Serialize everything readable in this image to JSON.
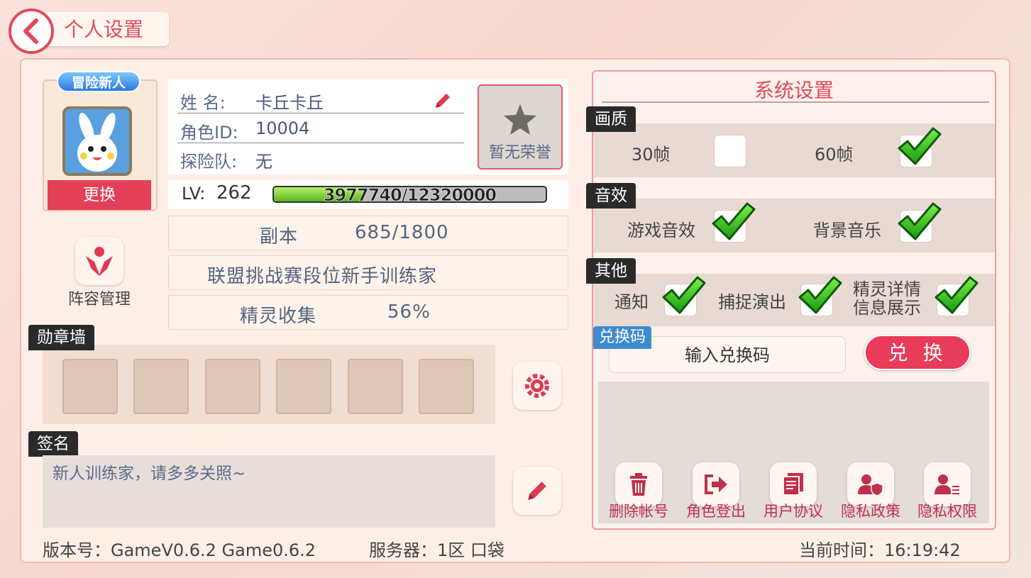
{
  "header": {
    "title": "个人设置"
  },
  "profile": {
    "badge": "冒险新人",
    "change_label": "更换",
    "roster_label": "阵容管理",
    "name_label": "姓  名:",
    "name_value": "卡丘卡丘",
    "id_label": "角色ID:",
    "id_value": "10004",
    "team_label": "探险队:",
    "team_value": "无",
    "honor_label": "暂无荣誉",
    "lv_label": "LV:",
    "lv_value": "262",
    "exp_text": "3977740/12320000",
    "exp_progress": 0.3228
  },
  "stats": {
    "dungeon_label": "副本",
    "dungeon_value": "685/1800",
    "league_text": "联盟挑战赛段位新手训练家",
    "collection_label": "精灵收集",
    "collection_value": "56%"
  },
  "medals": {
    "label": "勋章墙",
    "slots": 6
  },
  "signature": {
    "label": "签名",
    "text": "新人训练家，请多多关照~"
  },
  "footer": {
    "version": "版本号：GameV0.6.2 Game0.6.2",
    "server": "服务器：1区 口袋",
    "time": "当前时间：16:19:42"
  },
  "system": {
    "title": "系统设置",
    "quality": {
      "label": "画质",
      "opt30": "30帧",
      "opt60": "60帧",
      "opt30_checked": false,
      "opt60_checked": true
    },
    "sound": {
      "label": "音效",
      "game_sfx": "游戏音效",
      "bgm": "背景音乐"
    },
    "other": {
      "label": "其他",
      "notify": "通知",
      "capture": "捕捉演出",
      "detail_line1": "精灵详情",
      "detail_line2": "信息展示"
    },
    "redeem": {
      "tag": "兑换码",
      "placeholder": "输入兑换码",
      "button": "兑 换"
    },
    "actions": [
      {
        "label": "删除帐号",
        "icon": "trash-icon"
      },
      {
        "label": "角色登出",
        "icon": "logout-icon"
      },
      {
        "label": "用户协议",
        "icon": "document-icon"
      },
      {
        "label": "隐私政策",
        "icon": "privacy-shield-icon"
      },
      {
        "label": "隐私权限",
        "icon": "privacy-permission-icon"
      }
    ]
  },
  "colors": {
    "accent": "#e24a5d",
    "button_red": "#e43f58",
    "exp_green": "#7ad13a",
    "tag_blue": "#3e8bd0"
  }
}
